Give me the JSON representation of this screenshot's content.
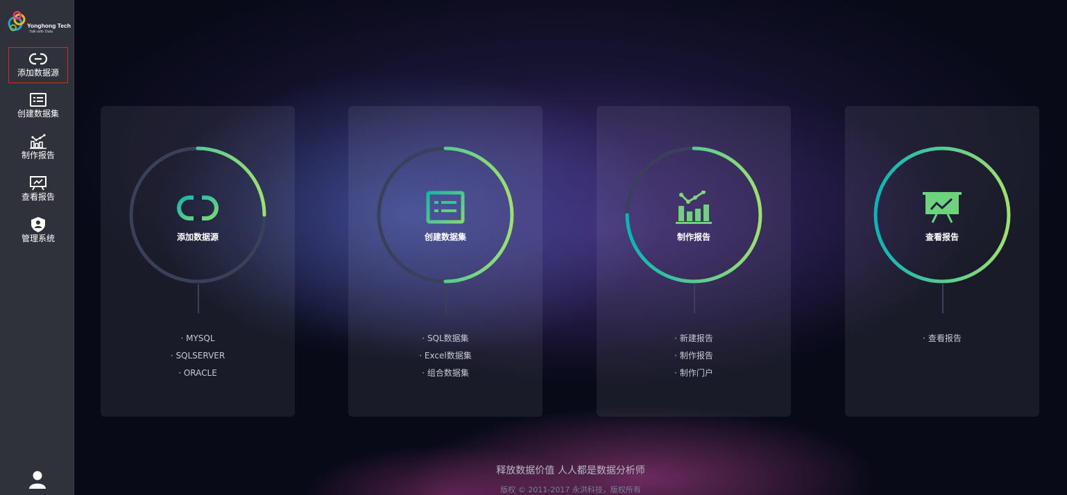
{
  "brand": {
    "name": "Yonghong Tech",
    "tagline": "Talk with Data"
  },
  "sidebar": {
    "items": [
      {
        "label": "添加数据源",
        "icon": "link-icon",
        "active": true
      },
      {
        "label": "创建数据集",
        "icon": "dataset-icon",
        "active": false
      },
      {
        "label": "制作报告",
        "icon": "bar-chart-icon",
        "active": false
      },
      {
        "label": "查看报告",
        "icon": "presentation-icon",
        "active": false
      },
      {
        "label": "管理系统",
        "icon": "shield-user-icon",
        "active": false
      }
    ],
    "user_icon": "user-icon"
  },
  "cards": [
    {
      "title": "添加数据源",
      "icon": "link-icon",
      "progress": 0.25,
      "links": [
        "MYSQL",
        "SQLSERVER",
        "ORACLE"
      ]
    },
    {
      "title": "创建数据集",
      "icon": "dataset-icon",
      "progress": 0.5,
      "links": [
        "SQL数据集",
        "Excel数据集",
        "组合数据集"
      ]
    },
    {
      "title": "制作报告",
      "icon": "bar-chart-icon",
      "progress": 0.75,
      "links": [
        "新建报告",
        "制作报告",
        "制作门户"
      ]
    },
    {
      "title": "查看报告",
      "icon": "presentation-icon",
      "progress": 1.0,
      "links": [
        "查看报告"
      ]
    }
  ],
  "footer": {
    "slogan": "释放数据价值 人人都是数据分析师",
    "copyright": "版权 © 2011-2017 永洪科技，版权所有"
  },
  "colors": {
    "sidebar_bg": "#2f323b",
    "active_border": "#d9262b",
    "ring_start": "#0ab4b7",
    "ring_end": "#9fe06f",
    "ring_track": "#3a3f5a"
  }
}
